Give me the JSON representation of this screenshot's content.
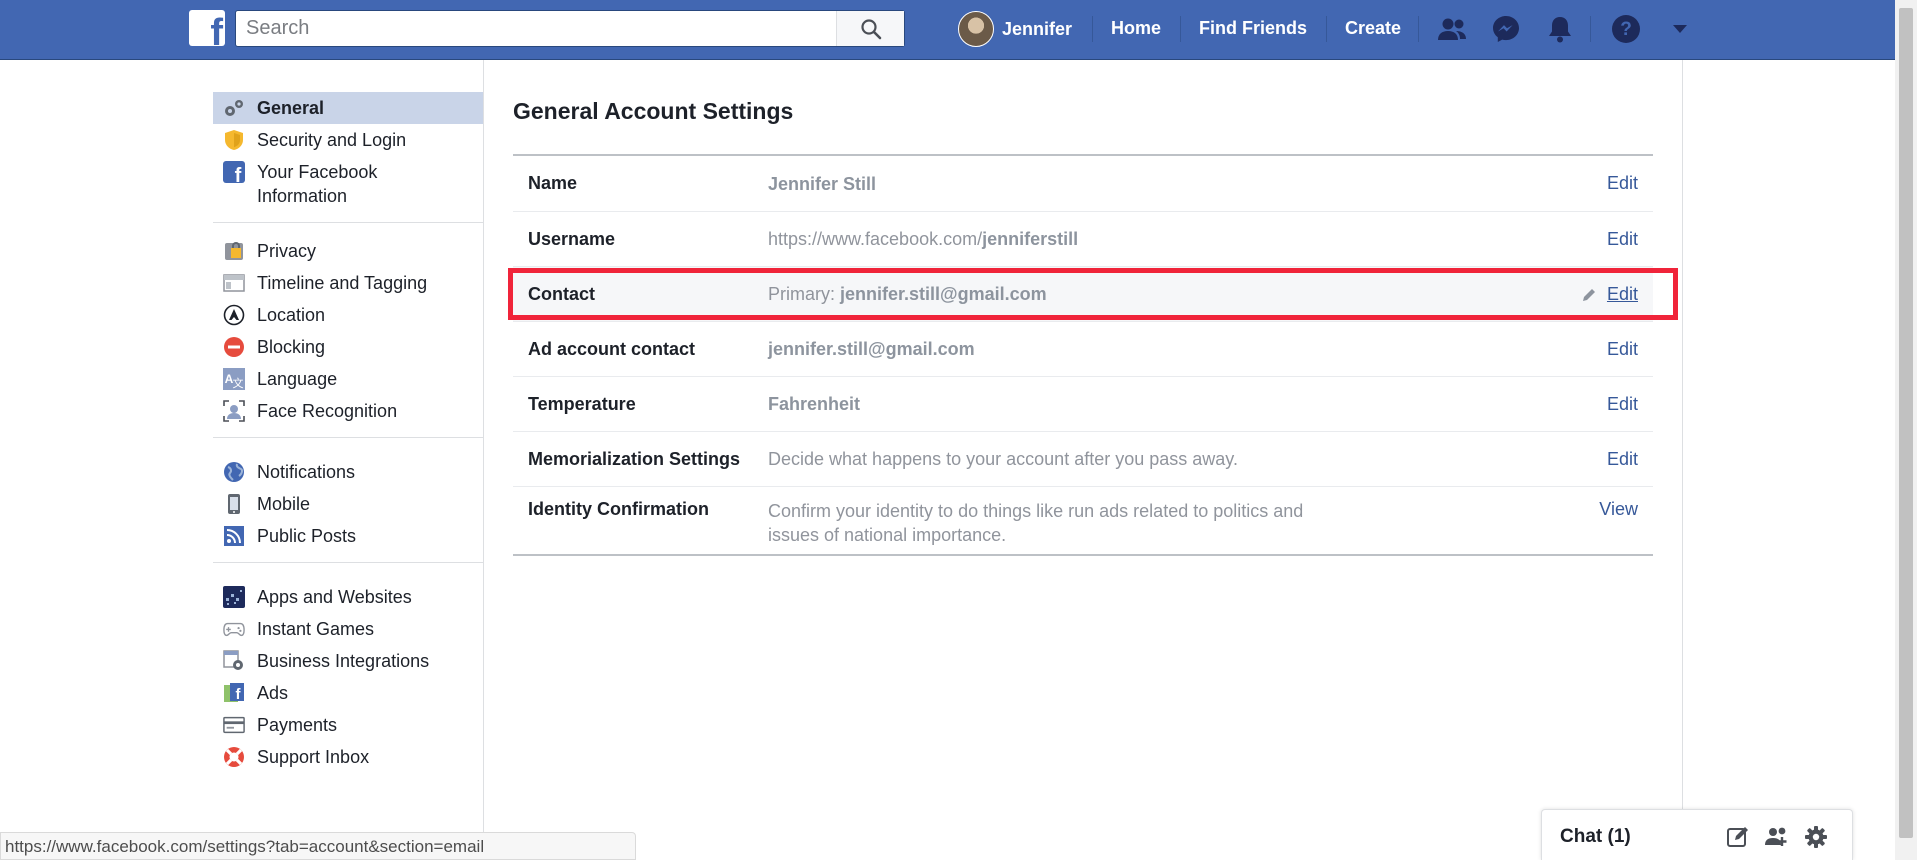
{
  "topbar": {
    "search_placeholder": "Search",
    "user_name": "Jennifer",
    "nav": [
      "Home",
      "Find Friends",
      "Create"
    ]
  },
  "sidebar": {
    "groups": [
      [
        {
          "label": "General",
          "icon": "gears-icon",
          "active": true
        },
        {
          "label": "Security and Login",
          "icon": "shield-icon"
        },
        {
          "label": "Your Facebook Information",
          "icon": "facebook-icon"
        }
      ],
      [
        {
          "label": "Privacy",
          "icon": "lock-icon"
        },
        {
          "label": "Timeline and Tagging",
          "icon": "timeline-icon"
        },
        {
          "label": "Location",
          "icon": "location-icon"
        },
        {
          "label": "Blocking",
          "icon": "blocking-icon"
        },
        {
          "label": "Language",
          "icon": "language-icon"
        },
        {
          "label": "Face Recognition",
          "icon": "face-recognition-icon"
        }
      ],
      [
        {
          "label": "Notifications",
          "icon": "globe-icon"
        },
        {
          "label": "Mobile",
          "icon": "mobile-icon"
        },
        {
          "label": "Public Posts",
          "icon": "rss-icon"
        }
      ],
      [
        {
          "label": "Apps and Websites",
          "icon": "apps-icon"
        },
        {
          "label": "Instant Games",
          "icon": "gamepad-icon"
        },
        {
          "label": "Business Integrations",
          "icon": "business-gear-icon"
        },
        {
          "label": "Ads",
          "icon": "ads-icon"
        },
        {
          "label": "Payments",
          "icon": "card-icon"
        },
        {
          "label": "Support Inbox",
          "icon": "lifebuoy-icon"
        }
      ]
    ]
  },
  "main": {
    "title": "General Account Settings",
    "rows": [
      {
        "label": "Name",
        "value_bold": "Jennifer Still",
        "action": "Edit"
      },
      {
        "label": "Username",
        "value_prefix": "https://www.facebook.com/",
        "value_bold": "jenniferstill",
        "action": "Edit"
      },
      {
        "label": "Contact",
        "value_prefix": "Primary: ",
        "value_bold": "jennifer.still@gmail.com",
        "action": "Edit",
        "highlighted": true
      },
      {
        "label": "Ad account contact",
        "value_bold": "jennifer.still@gmail.com",
        "action": "Edit"
      },
      {
        "label": "Temperature",
        "value_bold": "Fahrenheit",
        "action": "Edit"
      },
      {
        "label": "Memorialization Settings",
        "value": "Decide what happens to your account after you pass away.",
        "action": "Edit"
      },
      {
        "label": "Identity Confirmation",
        "value": "Confirm your identity to do things like run ads related to politics and issues of national importance.",
        "action": "View"
      }
    ]
  },
  "chat": {
    "label": "Chat (1)"
  },
  "statusbar": {
    "url": "https://www.facebook.com/settings?tab=account&section=email"
  },
  "colors": {
    "brand": "#4267b2",
    "highlight_border": "#f0243a",
    "link": "#365899"
  }
}
